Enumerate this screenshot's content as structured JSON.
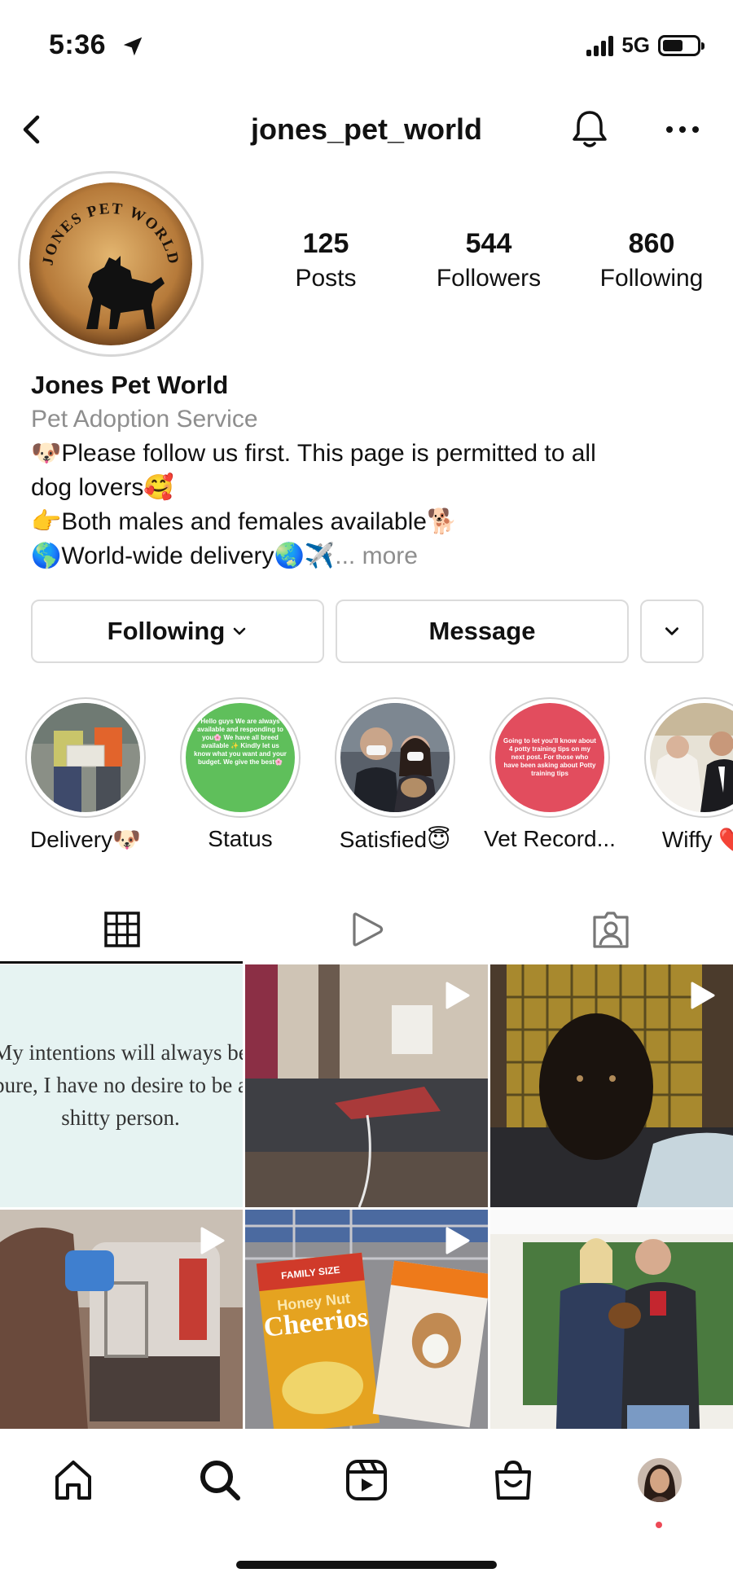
{
  "status_bar": {
    "time": "5:36",
    "network": "5G"
  },
  "header": {
    "username": "jones_pet_world"
  },
  "profile": {
    "logo_text": "JONES PET WORLD",
    "stats": [
      {
        "value": "125",
        "label": "Posts"
      },
      {
        "value": "544",
        "label": "Followers"
      },
      {
        "value": "860",
        "label": "Following"
      }
    ],
    "name": "Jones Pet World",
    "category": "Pet Adoption Service",
    "bio_lines": [
      "🐶Please follow us first. This page is permitted to all",
      "dog lovers🥰",
      "👉Both males and females available🐕",
      "🌎World-wide delivery🌏✈️"
    ],
    "bio_more": "... more"
  },
  "actions": {
    "following_label": "Following",
    "message_label": "Message"
  },
  "highlights": [
    {
      "label": "Delivery🐶"
    },
    {
      "label": "Status",
      "text": "Hello guys We are always available and responding to you🌸 We have all breed available ✨ Kindly let us know what you want and your budget. We give the best🌸"
    },
    {
      "label": "Satisfied😇"
    },
    {
      "label": "Vet Record...",
      "text": "Going to let you'll know about 4 potty training tips on my next post. For those who have been asking about Potty training tips"
    },
    {
      "label": "Wiffy ❤️"
    }
  ],
  "grid_posts": [
    {
      "type": "text",
      "text": "My intentions will always be pure, I have no desire to be a shitty person."
    },
    {
      "type": "video"
    },
    {
      "type": "video"
    },
    {
      "type": "video"
    },
    {
      "type": "video",
      "box_text_1": "FAMILY SIZE",
      "box_text_2": "Honey Nut",
      "box_text_3": "Cheerios"
    },
    {
      "type": "image"
    }
  ],
  "colors": {
    "accent_dot": "#ed4956",
    "category_gray": "#8e8e8e",
    "border": "#dbdbdb"
  },
  "bottom_nav": [
    "home-icon",
    "search-icon",
    "reels-icon",
    "shop-icon",
    "profile-avatar"
  ]
}
